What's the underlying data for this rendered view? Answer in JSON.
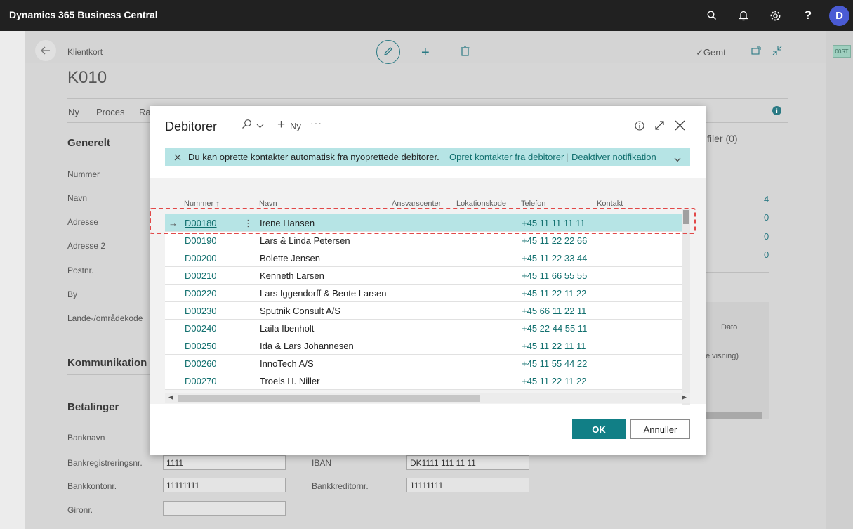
{
  "app": {
    "title": "Dynamics 365 Business Central",
    "avatar_initial": "D"
  },
  "topbar_icons": [
    "search-icon",
    "bell-icon",
    "gear-icon",
    "help-icon"
  ],
  "help_glyph": "?",
  "background_page": {
    "breadcrumb": "Klientkort",
    "record_title": "K010",
    "saved_label": "Gemt",
    "right_strip_tag": "00ST",
    "actions": [
      "Ny",
      "Proces",
      "Ra"
    ],
    "filer_label": "filer (0)",
    "sections": {
      "generelt": "Generelt",
      "kommunikation": "Kommunikation",
      "betalinger": "Betalinger"
    },
    "generelt_fields": [
      "Nummer",
      "Navn",
      "Adresse",
      "Adresse 2",
      "Postnr.",
      "By",
      "Lande-/områdekode"
    ],
    "right_counts": [
      "4",
      "0",
      "0",
      "0"
    ],
    "dato_label": "Dato",
    "visning_label": "e visning)",
    "betalinger_fields": {
      "banknavn_label": "Banknavn",
      "bankreg_label": "Bankregistreringsnr.",
      "bankreg_value": "1111",
      "bankkonto_label": "Bankkontonr.",
      "bankkonto_value": "11111111",
      "gironr_label": "Gironr.",
      "gironr_value": "",
      "iban_label": "IBAN",
      "iban_value": "DK1111 111 11 11",
      "bankkreditor_label": "Bankkreditornr.",
      "bankkreditor_value": "11111111"
    }
  },
  "modal": {
    "title": "Debitorer",
    "new_label": "Ny",
    "notification": {
      "message": "Du kan oprette kontakter automatisk fra nyoprettede debitorer.",
      "link1": "Opret kontakter fra debitorer",
      "separator": "|",
      "link2": "Deaktiver notifikation"
    },
    "columns": [
      "Nummer",
      "Navn",
      "Ansvarscenter",
      "Lokationskode",
      "Telefon",
      "Kontakt"
    ],
    "rows": [
      {
        "nummer": "D00180",
        "navn": "Irene Hansen",
        "telefon": "+45 11 11 11 11"
      },
      {
        "nummer": "D00190",
        "navn": "Lars & Linda Petersen",
        "telefon": "+45 11 22 22 66"
      },
      {
        "nummer": "D00200",
        "navn": "Bolette Jensen",
        "telefon": "+45 11 22 33 44"
      },
      {
        "nummer": "D00210",
        "navn": "Kenneth Larsen",
        "telefon": "+45 11 66 55 55"
      },
      {
        "nummer": "D00220",
        "navn": "Lars Iggendorff & Bente Larsen",
        "telefon": "+45 11 22 11 22"
      },
      {
        "nummer": "D00230",
        "navn": "Sputnik Consult A/S",
        "telefon": "+45 66 11 22 11"
      },
      {
        "nummer": "D00240",
        "navn": "Laila Ibenholt",
        "telefon": "+45 22 44 55 11"
      },
      {
        "nummer": "D00250",
        "navn": "Ida & Lars Johannesen",
        "telefon": "+45 11 22 11 11"
      },
      {
        "nummer": "D00260",
        "navn": "InnoTech A/S",
        "telefon": "+45 11 55 44 22"
      },
      {
        "nummer": "D00270",
        "navn": "Troels H. Niller",
        "telefon": "+45 11 22 11 22"
      }
    ],
    "ok_label": "OK",
    "cancel_label": "Annuller"
  },
  "colors": {
    "accent": "#117f86",
    "selected_row": "#b6e4e5",
    "highlight": "#e24848",
    "topbar": "#212121"
  }
}
